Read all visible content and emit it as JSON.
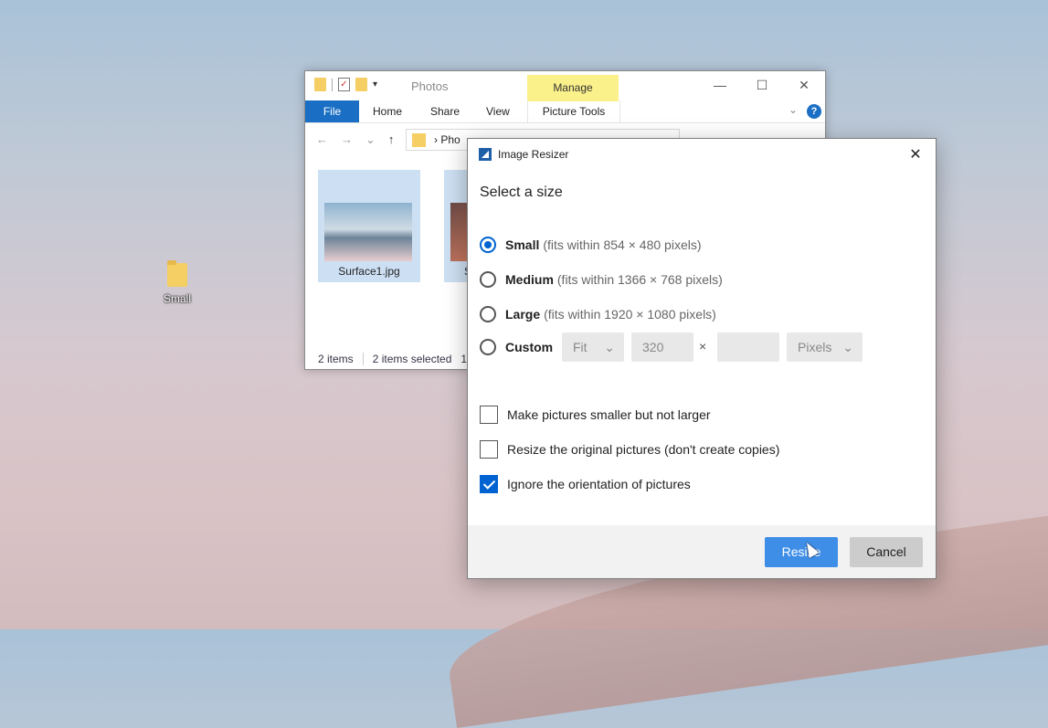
{
  "desktop": {
    "icon_label": "Small"
  },
  "explorer": {
    "title": "Photos",
    "manage_label": "Manage",
    "tabs": [
      "File",
      "Home",
      "Share",
      "View",
      "Picture Tools"
    ],
    "address_path": "Pho",
    "thumbnails": [
      {
        "caption": "Surface1.jpg"
      },
      {
        "caption": "S"
      }
    ],
    "status_items": "2 items",
    "status_selected": "2 items selected",
    "status_extra": "1"
  },
  "dialog": {
    "title": "Image Resizer",
    "heading": "Select a size",
    "options": [
      {
        "name": "Small",
        "hint": "(fits within 854 × 480 pixels)",
        "selected": true
      },
      {
        "name": "Medium",
        "hint": "(fits within 1366 × 768 pixels)",
        "selected": false
      },
      {
        "name": "Large",
        "hint": "(fits within 1920 × 1080 pixels)",
        "selected": false
      },
      {
        "name": "Custom",
        "hint": "",
        "selected": false
      }
    ],
    "custom": {
      "fit": "Fit",
      "width": "320",
      "times": "×",
      "height": "",
      "unit": "Pixels"
    },
    "checkboxes": [
      {
        "label": "Make pictures smaller but not larger",
        "checked": false
      },
      {
        "label": "Resize the original pictures (don't create copies)",
        "checked": false
      },
      {
        "label": "Ignore the orientation of pictures",
        "checked": true
      }
    ],
    "resize_button": "Resize",
    "cancel_button": "Cancel"
  },
  "colors": {
    "accent": "#0063d1",
    "primary_button": "#3e8ee8"
  }
}
